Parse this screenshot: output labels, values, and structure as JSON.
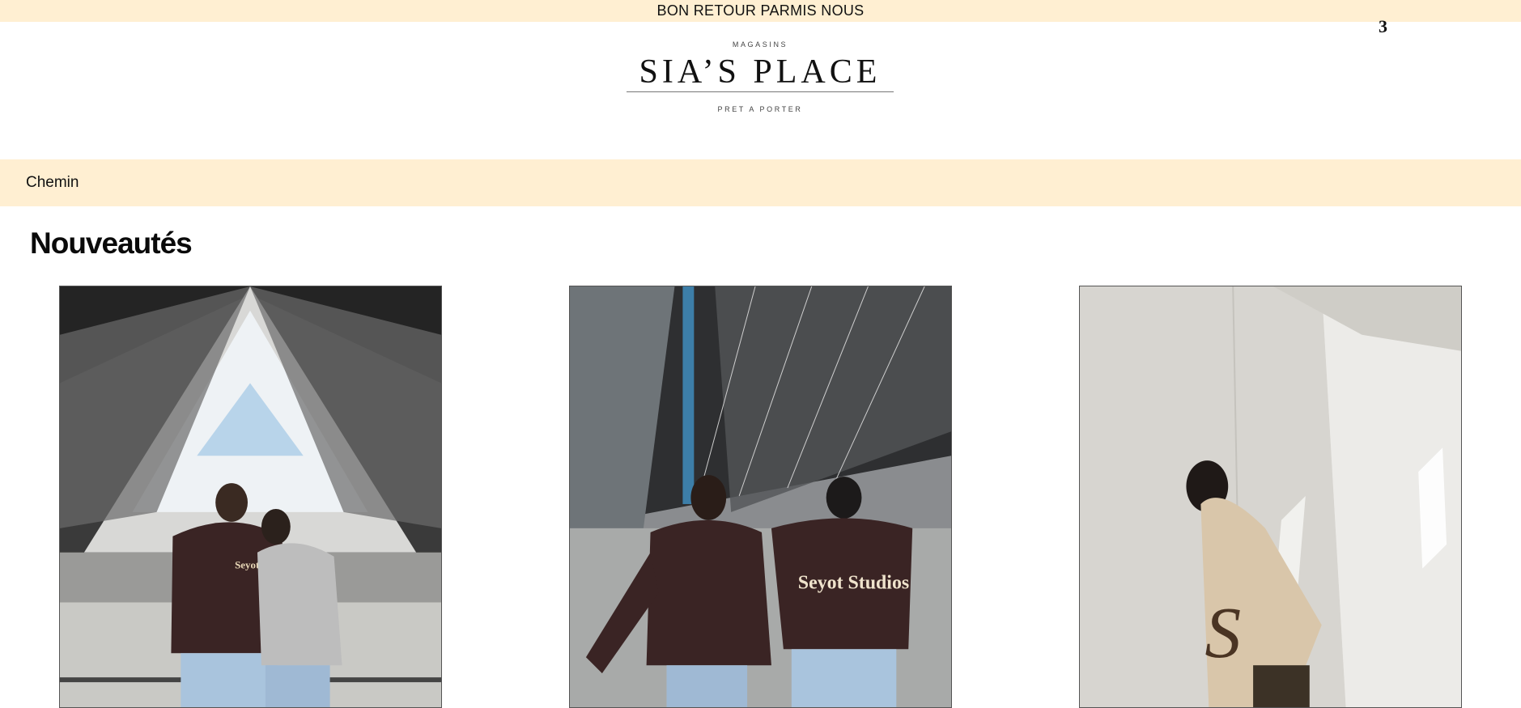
{
  "announcement": {
    "text": "BON RETOUR PARMIS NOUS"
  },
  "cart": {
    "count": "3"
  },
  "logo": {
    "top_text": "MAGASINS",
    "name": "SIA’S PLACE",
    "bottom_text": "PRET A PORTER"
  },
  "breadcrumb": {
    "label": "Chemin"
  },
  "section": {
    "title": "Nouveautés"
  },
  "products": [
    {
      "image": "couple-hoodies-architecture-photo",
      "print": "Seyot Studios"
    },
    {
      "image": "two-men-hoodies-parking-photo",
      "print": "Seyot Studios"
    },
    {
      "image": "woman-tshirt-wall-photo",
      "print": "S"
    }
  ],
  "colors": {
    "banner_bg": "#ffefd2",
    "hoodie_brown": "#3a2424",
    "text": "#111111"
  }
}
